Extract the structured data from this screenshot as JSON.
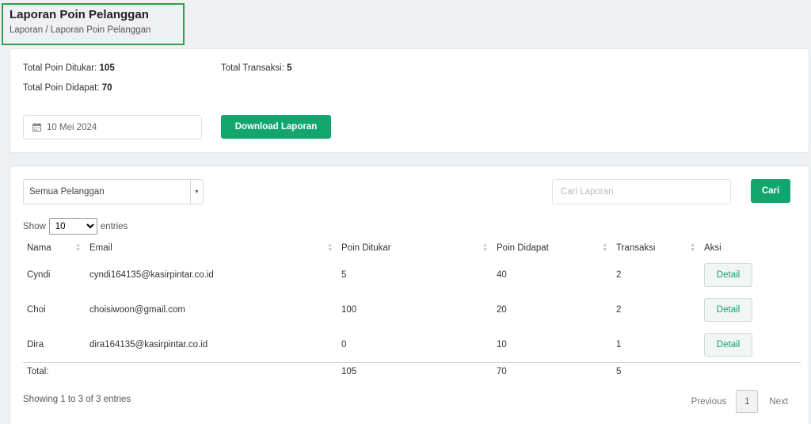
{
  "header": {
    "title": "Laporan Poin Pelanggan",
    "breadcrumb": "Laporan / Laporan Poin Pelanggan"
  },
  "summary": {
    "total_poin_ditukar_label": "Total Poin Ditukar:",
    "total_poin_ditukar_value": "105",
    "total_transaksi_label": "Total Transaksi:",
    "total_transaksi_value": "5",
    "total_poin_didapat_label": "Total Poin Didapat:",
    "total_poin_didapat_value": "70",
    "date_value": "10 Mei 2024",
    "download_label": "Download Laporan"
  },
  "filters": {
    "customer_select": "Semua Pelanggan",
    "search_placeholder": "Cari Laporan",
    "search_button": "Cari",
    "show_label": "Show",
    "entries_value": "10",
    "entries_label": "entries"
  },
  "table": {
    "columns": [
      "Nama",
      "Email",
      "Poin Ditukar",
      "Poin Didapat",
      "Transaksi",
      "Aksi"
    ],
    "rows": [
      {
        "nama": "Cyndi",
        "email": "cyndi164135@kasirpintar.co.id",
        "poin_ditukar": "5",
        "poin_didapat": "40",
        "transaksi": "2",
        "aksi": "Detail"
      },
      {
        "nama": "Choi",
        "email": "choisiwoon@gmail.com",
        "poin_ditukar": "100",
        "poin_didapat": "20",
        "transaksi": "2",
        "aksi": "Detail"
      },
      {
        "nama": "Dira",
        "email": "dira164135@kasirpintar.co.id",
        "poin_ditukar": "0",
        "poin_didapat": "10",
        "transaksi": "1",
        "aksi": "Detail"
      }
    ],
    "total": {
      "label": "Total:",
      "poin_ditukar": "105",
      "poin_didapat": "70",
      "transaksi": "5"
    }
  },
  "footer": {
    "info": "Showing 1 to 3 of 3 entries",
    "previous": "Previous",
    "page": "1",
    "next": "Next"
  },
  "colors": {
    "accent": "#12a56d",
    "highlight_border": "#2aa34a",
    "background": "#eef0f3"
  },
  "icons": {
    "date": "calendar-icon",
    "sort": "sort-icon",
    "select_caret": "caret-down-icon"
  }
}
